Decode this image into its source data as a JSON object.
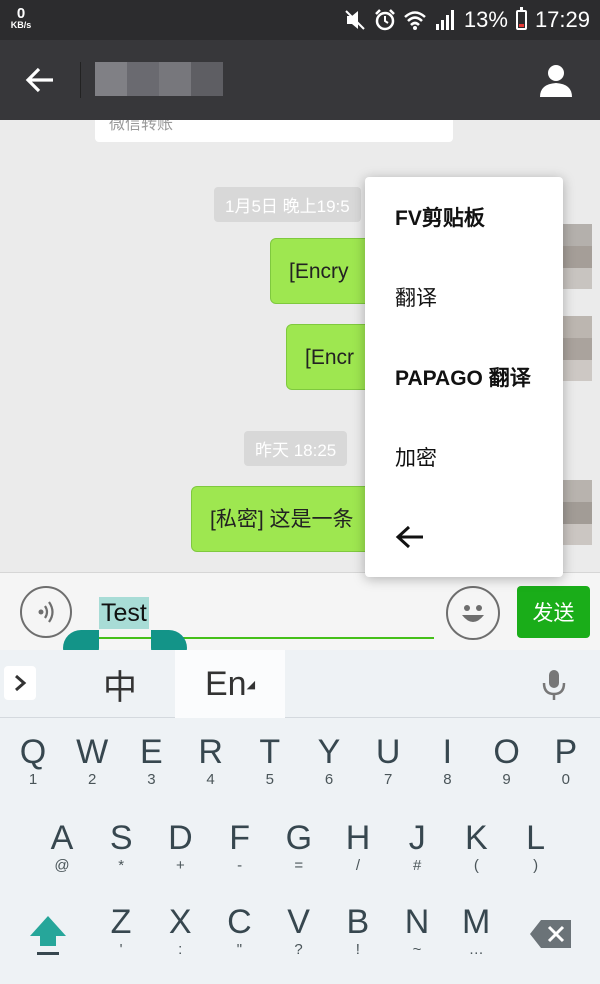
{
  "status_bar": {
    "net_speed": "0",
    "net_unit": "KB/s",
    "battery": "13%",
    "time": "17:29"
  },
  "title_bar": {
    "back_icon": "arrow-left-icon",
    "profile_icon": "person-icon"
  },
  "chat": {
    "transfer_label": "微信转账",
    "timestamps": [
      "1月5日 晚上19:5",
      "昨天 18:25"
    ],
    "messages": [
      "[Encry",
      "[Encr",
      "[私密] 这是一条"
    ]
  },
  "context_menu": {
    "items": [
      "FV剪贴板",
      "翻译",
      "PAPAGO 翻译",
      "加密"
    ],
    "back_icon": "arrow-left-icon"
  },
  "input_bar": {
    "text_value": "Test",
    "send_label": "发送",
    "voice_icon": "voice-icon",
    "emoji_icon": "emoji-icon"
  },
  "keyboard": {
    "lang_zh": "中",
    "lang_en": "En",
    "row1": [
      {
        "k": "Q",
        "s": "1"
      },
      {
        "k": "W",
        "s": "2"
      },
      {
        "k": "E",
        "s": "3"
      },
      {
        "k": "R",
        "s": "4"
      },
      {
        "k": "T",
        "s": "5"
      },
      {
        "k": "Y",
        "s": "6"
      },
      {
        "k": "U",
        "s": "7"
      },
      {
        "k": "I",
        "s": "8"
      },
      {
        "k": "O",
        "s": "9"
      },
      {
        "k": "P",
        "s": "0"
      }
    ],
    "row2": [
      {
        "k": "A",
        "s": "@"
      },
      {
        "k": "S",
        "s": "*"
      },
      {
        "k": "D",
        "s": "+"
      },
      {
        "k": "F",
        "s": "-"
      },
      {
        "k": "G",
        "s": "="
      },
      {
        "k": "H",
        "s": "/"
      },
      {
        "k": "J",
        "s": "#"
      },
      {
        "k": "K",
        "s": "("
      },
      {
        "k": "L",
        "s": ")"
      }
    ],
    "row3": [
      {
        "k": "Z",
        "s": "'"
      },
      {
        "k": "X",
        "s": ":"
      },
      {
        "k": "C",
        "s": "\""
      },
      {
        "k": "V",
        "s": "?"
      },
      {
        "k": "B",
        "s": "!"
      },
      {
        "k": "N",
        "s": "~"
      },
      {
        "k": "M",
        "s": "…"
      }
    ]
  },
  "colors": {
    "bubble_green": "#9ee750",
    "send_green": "#1aad19",
    "selection_teal": "#139488",
    "title_bar": "#37373a"
  }
}
